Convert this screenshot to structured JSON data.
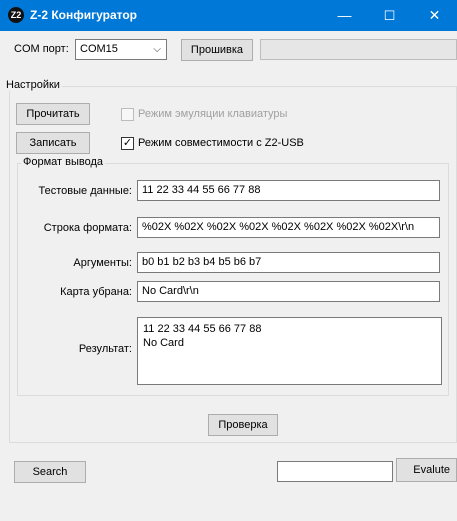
{
  "window": {
    "icon_text": "Z2",
    "title": "Z-2  Конфигуратор",
    "controls": {
      "minimize": "—",
      "maximize": "☐",
      "close": "✕"
    }
  },
  "top": {
    "com_label": "COM порт:",
    "com_value": "COM15",
    "firmware_button": "Прошивка"
  },
  "settings": {
    "title": "Настройки",
    "read_button": "Прочитать",
    "write_button": "Записать",
    "keyboard_emulation": {
      "label": "Режим эмуляции клавиатуры",
      "checked": false,
      "enabled": false
    },
    "z2usb_compat": {
      "label": "Режим совместимости с Z2-USB",
      "checked": true,
      "enabled": true
    }
  },
  "output_format": {
    "title": "Формат вывода",
    "test_data_label": "Тестовые данные:",
    "test_data_value": "11 22 33 44 55 66 77 88",
    "format_string_label": "Строка формата:",
    "format_string_value": "%02X %02X %02X %02X %02X %02X %02X %02X\\r\\n",
    "args_label": "Аргументы:",
    "args_value": "b0 b1 b2 b3 b4 b5 b6 b7",
    "card_removed_label": "Карта убрана:",
    "card_removed_value": "No Card\\r\\n",
    "result_label": "Результат:",
    "result_line1": "11 22 33 44 55 66 77 88",
    "result_line2": "No Card",
    "check_button": "Проверка"
  },
  "bottom": {
    "search_button": "Search",
    "evaluate_input_value": "",
    "evaluate_button": "Evalute"
  }
}
